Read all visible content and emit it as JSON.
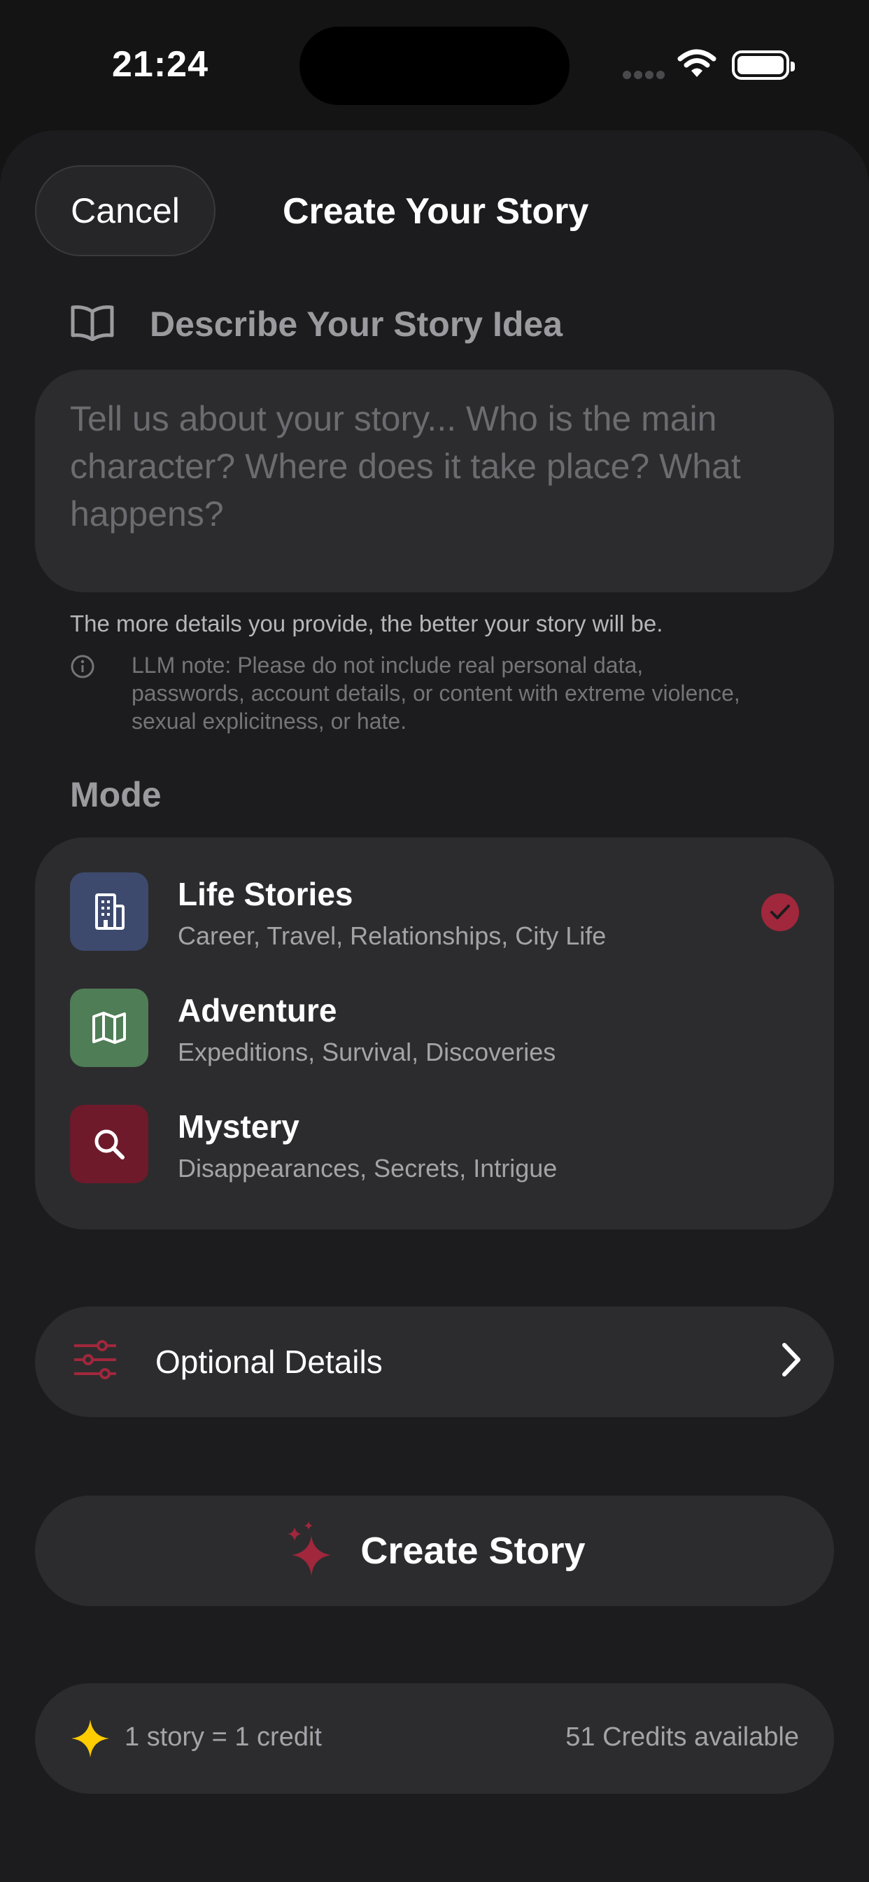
{
  "status_bar": {
    "time": "21:24"
  },
  "header": {
    "cancel_label": "Cancel",
    "title": "Create Your Story"
  },
  "idea": {
    "section_label": "Describe Your Story Idea",
    "placeholder": "Tell us about your story... Who is the main character? Where does it take place? What happens?",
    "value": "",
    "hint": "The more details you provide, the better your story will be.",
    "note": "LLM note: Please do not include real personal data, passwords, account details, or content with extreme violence, sexual explicitness, or hate."
  },
  "mode": {
    "title": "Mode",
    "selected": "Life Stories",
    "items": [
      {
        "name": "Life Stories",
        "sub": "Career, Travel, Relationships, City Life",
        "icon": "building-icon",
        "color": "#3d4a6e"
      },
      {
        "name": "Adventure",
        "sub": "Expeditions, Survival, Discoveries",
        "icon": "map-icon",
        "color": "#4f7d56"
      },
      {
        "name": "Mystery",
        "sub": "Disappearances, Secrets, Intrigue",
        "icon": "magnifier-icon",
        "color": "#6e1a2b"
      }
    ]
  },
  "optional_details": {
    "label": "Optional Details",
    "icon": "sliders-icon"
  },
  "create": {
    "label": "Create Story",
    "icon": "sparkles-icon"
  },
  "credits": {
    "cost_label": "1 story = 1 credit",
    "available_label": "51 Credits available",
    "icon": "sparkle-icon"
  },
  "colors": {
    "accent": "#a1273c",
    "background": "#1c1c1e",
    "card": "#2c2c2e",
    "star": "#ffcc00"
  }
}
